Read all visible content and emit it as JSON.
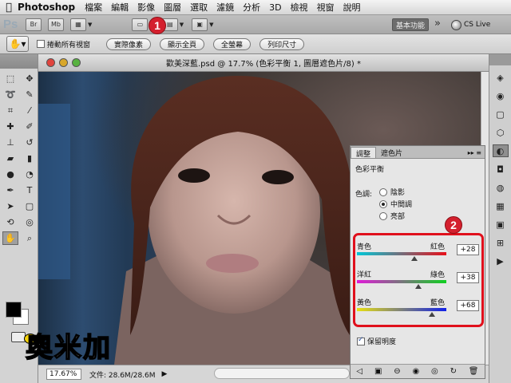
{
  "menubar": {
    "app_name": "Photoshop",
    "items": [
      "檔案",
      "編輯",
      "影像",
      "圖層",
      "選取",
      "濾鏡",
      "分析",
      "3D",
      "檢視",
      "視窗",
      "說明"
    ]
  },
  "appbar": {
    "ps_logo": "Ps",
    "br_label": "Br",
    "mb_label": "Mb",
    "badge1": "1",
    "workspace_label": "基本功能",
    "cslive_label": "CS Live"
  },
  "optbar": {
    "scroll_all_label": "捲動所有視窗",
    "buttons": [
      "實際像素",
      "顯示全頁",
      "全螢幕",
      "列印尺寸"
    ]
  },
  "document": {
    "title": "歡美深藍.psd @ 17.7% (色彩平衡 1, 圖層遮色片/8) *",
    "zoom": "17.67%",
    "doc_info": "文件: 28.6M/28.6M"
  },
  "adjustments": {
    "tabs": [
      "調整",
      "遮色片"
    ],
    "title": "色彩平衡",
    "tone_label": "色調:",
    "tones": [
      "陰影",
      "中間調",
      "亮部"
    ],
    "selected_tone": 1,
    "badge2": "2",
    "sliders": [
      {
        "left": "青色",
        "right": "紅色",
        "value": "+28",
        "level": 28,
        "track_from": "#00c8d8",
        "track_to": "#e8101a"
      },
      {
        "left": "洋紅",
        "right": "綠色",
        "value": "+38",
        "level": 38,
        "track_from": "#e01ad8",
        "track_to": "#10d020"
      },
      {
        "left": "黃色",
        "right": "藍色",
        "value": "+68",
        "level": 68,
        "track_from": "#e8e010",
        "track_to": "#1020e8"
      }
    ],
    "preserve_label": "保留明度"
  },
  "watermark": {
    "text": "奧米加"
  }
}
